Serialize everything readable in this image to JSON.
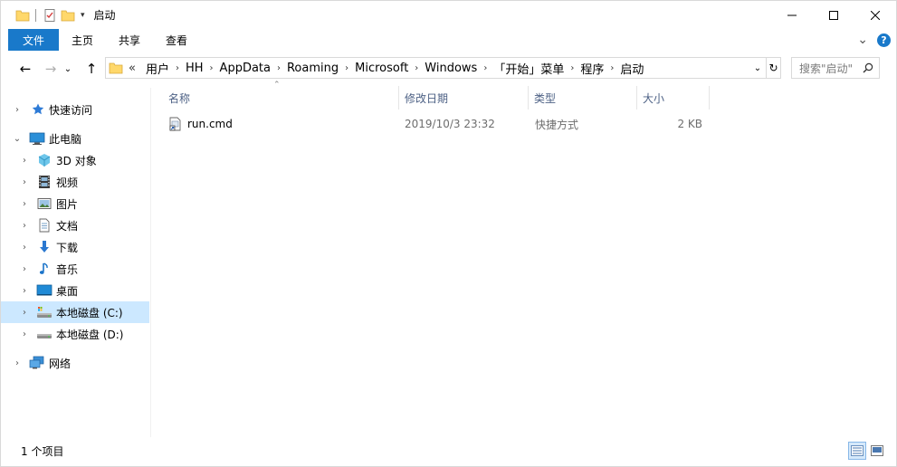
{
  "titlebar": {
    "title": "启动",
    "minimize_label": "—",
    "maximize_label": "☐",
    "close_label": "✕"
  },
  "ribbon": {
    "tabs": [
      {
        "label": "文件"
      },
      {
        "label": "主页"
      },
      {
        "label": "共享"
      },
      {
        "label": "查看"
      }
    ],
    "expand_glyph": "⌄",
    "help_glyph": "?"
  },
  "address": {
    "back_glyph": "←",
    "forward_glyph": "→",
    "recent_glyph": "⌄",
    "up_glyph": "↑",
    "overflow": "«",
    "crumbs": [
      "用户",
      "HH",
      "AppData",
      "Roaming",
      "Microsoft",
      "Windows",
      "「开始」菜单",
      "程序",
      "启动"
    ],
    "search_placeholder": "搜索\"启动\""
  },
  "nav": {
    "items": [
      {
        "label": "快速访问",
        "icon": "star-icon",
        "level": 0,
        "expanded": false
      },
      {
        "label": "此电脑",
        "icon": "computer-icon",
        "level": 0,
        "expanded": true
      },
      {
        "label": "3D 对象",
        "icon": "cube-icon",
        "level": 1,
        "expanded": false
      },
      {
        "label": "视频",
        "icon": "film-icon",
        "level": 1,
        "expanded": false
      },
      {
        "label": "图片",
        "icon": "picture-icon",
        "level": 1,
        "expanded": false
      },
      {
        "label": "文档",
        "icon": "document-icon",
        "level": 1,
        "expanded": false
      },
      {
        "label": "下载",
        "icon": "download-icon",
        "level": 1,
        "expanded": false
      },
      {
        "label": "音乐",
        "icon": "music-icon",
        "level": 1,
        "expanded": false
      },
      {
        "label": "桌面",
        "icon": "desktop-icon",
        "level": 1,
        "expanded": false
      },
      {
        "label": "本地磁盘 (C:)",
        "icon": "drive-c-icon",
        "level": 1,
        "expanded": false,
        "selected": true
      },
      {
        "label": "本地磁盘 (D:)",
        "icon": "drive-icon",
        "level": 1,
        "expanded": false
      },
      {
        "label": "网络",
        "icon": "network-icon",
        "level": 0,
        "expanded": false
      }
    ]
  },
  "columns": [
    {
      "label": "名称"
    },
    {
      "label": "修改日期"
    },
    {
      "label": "类型"
    },
    {
      "label": "大小"
    }
  ],
  "sort_arrow": "⌃",
  "files": [
    {
      "name": "run.cmd",
      "modified": "2019/10/3 23:32",
      "type": "快捷方式",
      "size": "2 KB",
      "icon": "shortcut-file-icon"
    }
  ],
  "status": {
    "count_text": "1 个项目",
    "view_mode": "details"
  },
  "colors": {
    "accent": "#1979ca",
    "selection": "#cce8ff",
    "header_text": "#4d6185"
  }
}
